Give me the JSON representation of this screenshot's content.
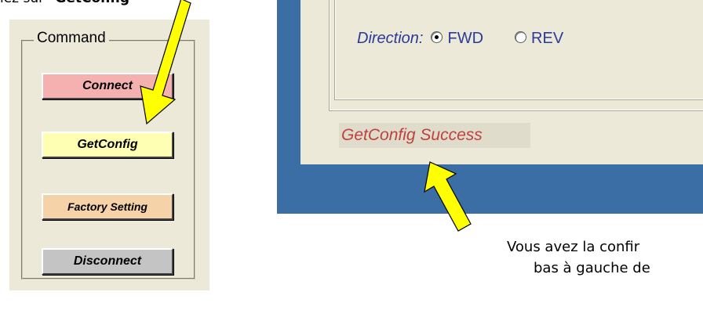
{
  "caption_top": {
    "prefix": "lez sur ",
    "highlight": "\"GetConfig\""
  },
  "command_panel": {
    "legend": "Command",
    "buttons": {
      "connect": "Connect",
      "getconfig": "GetConfig",
      "factory": "Factory Setting",
      "disconnect": "Disconnect"
    }
  },
  "settings_panel": {
    "direction_label": "Direction:",
    "options": {
      "fwd": "FWD",
      "rev": "REV"
    },
    "selected": "FWD",
    "status": "GetConfig Success"
  },
  "caption_bottom": {
    "line1": "Vous avez la confir",
    "line2": "bas à gauche de"
  },
  "colors": {
    "window_bg": "#ece9d8",
    "desktop_blue": "#3a6ea5",
    "connect_btn": "#f5b0b0",
    "getconfig_btn": "#ffffb4",
    "factory_btn": "#f5d2a8",
    "disconnect_btn": "#c4c4c4",
    "status_text": "#c04040",
    "direction_text": "#2a3a9a",
    "arrow": "#ffff00"
  }
}
